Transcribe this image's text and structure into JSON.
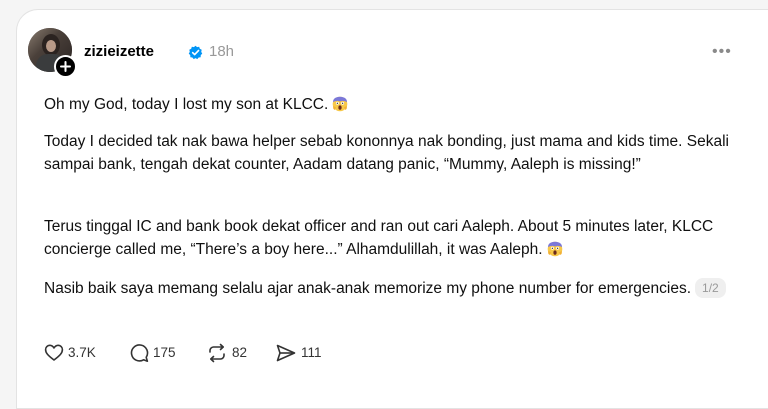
{
  "post": {
    "username": "zizieizette",
    "time": "18h",
    "more": "•••",
    "paragraphs": {
      "p1": "Oh my God, today I lost my son at KLCC.",
      "p2": "Today I decided tak nak bawa helper sebab kononnya nak bonding, just mama and kids time. Sekali sampai bank, tengah dekat counter, Aadam datang panic, “Mummy, Aaleph is missing!”",
      "p3": "Terus tinggal IC and bank book dekat officer and ran out cari Aaleph. About 5 minutes later, KLCC concierge called me, “There’s a boy here...” Alhamdulillah, it was Aaleph.",
      "p4": "Nasib baik saya memang selalu ajar anak-anak memorize my phone number for emergencies."
    },
    "thread_indicator": "1/2",
    "actions": {
      "likes": "3.7K",
      "comments": "175",
      "reposts": "82",
      "shares": "111"
    }
  },
  "icons": {
    "avatar": "profile-photo",
    "follow": "plus-icon",
    "verified": "verified-badge-icon",
    "emoji": "screaming-face-emoji",
    "like": "heart-icon",
    "comment": "comment-bubble-icon",
    "repost": "repost-icon",
    "share": "send-icon"
  },
  "colors": {
    "verified": "#0095f6",
    "text": "#101010",
    "muted": "#999999"
  }
}
